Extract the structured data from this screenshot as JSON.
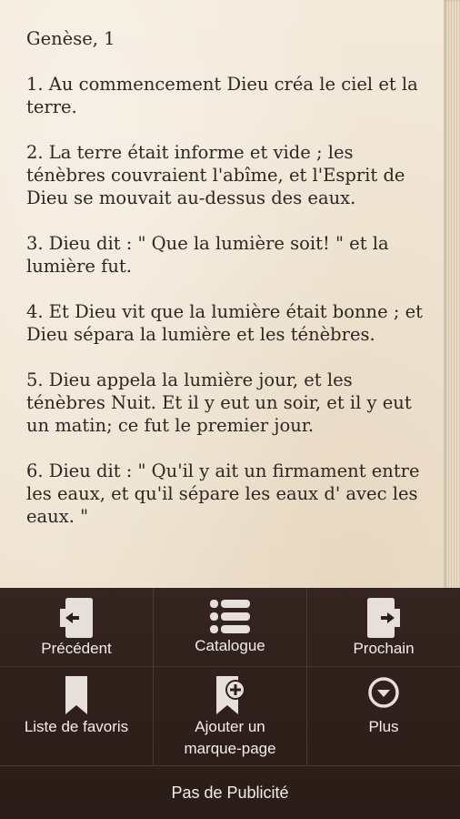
{
  "reader": {
    "chapter_title": "Genèse, 1",
    "verses": [
      "1. Au commencement Dieu créa le ciel et la terre.",
      "2. La terre était informe et vide ; les ténèbres couvraient l'abîme, et l'Esprit de Dieu se mouvait au-dessus des eaux.",
      "3. Dieu dit : \" Que la lumière soit! \" et la lumière fut.",
      "4. Et Dieu vit que la lumière était bonne ; et Dieu sépara la lumière et les ténèbres.",
      "5. Dieu appela la lumière jour, et les ténèbres Nuit. Et il y eut un soir, et il y eut un matin; ce fut le premier jour.",
      "6. Dieu dit : \" Qu'il y ait un firmament entre les eaux, et qu'il sépare les eaux d' avec les eaux. \""
    ]
  },
  "menu": {
    "previous_label": "Précédent",
    "catalogue_label": "Catalogue",
    "next_label": "Prochain",
    "favorites_label": "Liste de favoris",
    "add_bookmark_label_line1": "Ajouter un",
    "add_bookmark_label_line2": "marque-page",
    "more_label": "Plus",
    "no_ads_label": "Pas de Publicité"
  },
  "icons": {
    "previous": "page-back-icon",
    "catalogue": "list-icon",
    "next": "page-forward-icon",
    "favorites": "bookmark-icon",
    "add_bookmark": "bookmark-add-icon",
    "more": "chevron-down-circle-icon"
  },
  "colors": {
    "page_background": "#f1e6d6",
    "text": "#2d2722",
    "menu_background": "#2e1f1a",
    "menu_text": "#f4eeea",
    "icon": "#e7dfda"
  }
}
